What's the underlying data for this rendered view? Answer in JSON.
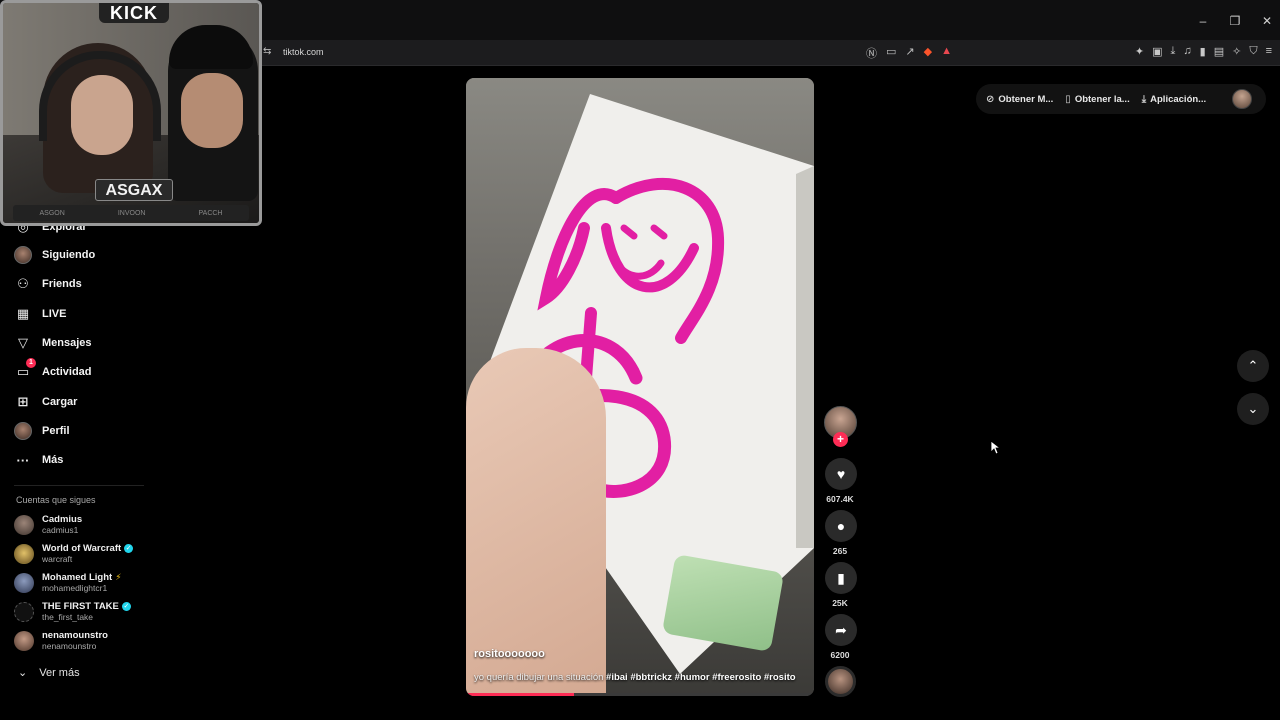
{
  "browser": {
    "url": "tiktok.com",
    "window_controls": [
      "–",
      "❐",
      "✕"
    ]
  },
  "stream_overlay": {
    "platform": "KICK",
    "streamer": "ASGAX",
    "bottom_labels": [
      "ASGON",
      "INVOON",
      "PACCH"
    ]
  },
  "sidebar": {
    "items": [
      {
        "icon": "compass-icon",
        "label": "Explorar"
      },
      {
        "icon": "following-avatar",
        "label": "Siguiendo"
      },
      {
        "icon": "friends-icon",
        "label": "Friends"
      },
      {
        "icon": "live-icon",
        "label": "LIVE"
      },
      {
        "icon": "send-icon",
        "label": "Mensajes"
      },
      {
        "icon": "activity-icon",
        "label": "Actividad",
        "badge": "1"
      },
      {
        "icon": "upload-icon",
        "label": "Cargar"
      },
      {
        "icon": "profile-avatar",
        "label": "Perfil"
      },
      {
        "icon": "more-icon",
        "label": "Más"
      }
    ],
    "following_title": "Cuentas que sigues",
    "following": [
      {
        "name": "Cadmius",
        "handle": "cadmius1",
        "verified": false,
        "bolt": false,
        "color": "#6b5a4f"
      },
      {
        "name": "World of Warcraft",
        "handle": "warcraft",
        "verified": true,
        "bolt": false,
        "color": "#c8a04a"
      },
      {
        "name": "Mohamed Light",
        "handle": "mohamedlightcr1",
        "verified": false,
        "bolt": true,
        "color": "#5d6c8a"
      },
      {
        "name": "THE FIRST TAKE",
        "handle": "the_first_take",
        "verified": true,
        "bolt": false,
        "color": "#1b1b1b"
      },
      {
        "name": "nenamounstro",
        "handle": "nenamounstro",
        "verified": false,
        "bolt": false,
        "color": "#8a6a5b"
      }
    ],
    "see_more": "Ver más"
  },
  "topbar": {
    "items": [
      "Obtener M...",
      "Obtener la...",
      "Aplicación..."
    ]
  },
  "video": {
    "author": "rositooooooo",
    "caption_text": "yo quería dibujar una situación",
    "hashtags": "#ibai #bbtrickz #humor #freerosito #rosito",
    "progress": 0.31
  },
  "actions": {
    "likes": "607.4K",
    "comments": "265",
    "saves": "25K",
    "shares": "6200"
  },
  "colors": {
    "accent": "#fe2c55",
    "verified": "#20d5ec",
    "background": "#000000"
  }
}
